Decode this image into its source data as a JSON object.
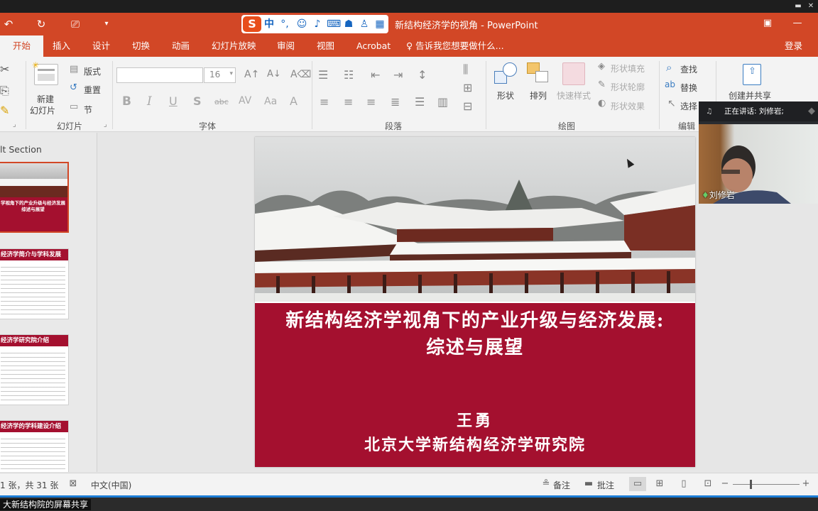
{
  "titlebar": {
    "title": "新结构经济学的视角 - PowerPoint",
    "ime": {
      "logo": "S",
      "mode": "中",
      "punct": "°,"
    }
  },
  "tabs": [
    {
      "label": "开始"
    },
    {
      "label": "插入"
    },
    {
      "label": "设计"
    },
    {
      "label": "切换"
    },
    {
      "label": "动画"
    },
    {
      "label": "幻灯片放映"
    },
    {
      "label": "审阅"
    },
    {
      "label": "视图"
    },
    {
      "label": "Acrobat"
    }
  ],
  "tellme": "告诉我您想要做什么...",
  "login": "登录",
  "ribbon": {
    "slides": {
      "new_slide": "新建",
      "new_slide2": "幻灯片",
      "layout": "版式",
      "reset": "重置",
      "section": "节",
      "group": "幻灯片"
    },
    "font": {
      "size": "16",
      "group": "字体",
      "bold": "B",
      "italic": "I",
      "underline": "U",
      "shadow": "S",
      "strike": "abc",
      "spacing": "AV",
      "case": "Aa",
      "color": "A"
    },
    "paragraph": {
      "group": "段落"
    },
    "drawing": {
      "shapes": "形状",
      "arrange": "排列",
      "quick_styles": "快速样式",
      "fill": "形状填充",
      "outline": "形状轮廓",
      "effects": "形状效果",
      "group": "绘图"
    },
    "editing": {
      "find": "查找",
      "replace": "替换",
      "select": "选择",
      "group": "编辑"
    },
    "share": {
      "label": "创建并共享"
    }
  },
  "thumbnails": {
    "section": "lt Section",
    "items": [
      {
        "head": "学视角下的产业升级与经济发展",
        "sub": "综述与展望"
      },
      {
        "head": "经济学简介与学科发展"
      },
      {
        "head": "经济学研究院介绍"
      },
      {
        "head": "经济学的学科建设介绍"
      }
    ]
  },
  "slide": {
    "title_line1": "新结构经济学视角下的产业升级与经济发展:",
    "title_line2": "综述与展望",
    "author": "王勇",
    "institution": "北京大学新结构经济学研究院"
  },
  "video": {
    "speaking": "正在讲话: 刘修岩;",
    "name": "刘修岩"
  },
  "status": {
    "slide_count": "1 张，共 31 张",
    "language": "中文(中国)",
    "notes": "备注",
    "comments": "批注"
  },
  "share": {
    "label": "大新结构院的屏幕共享"
  },
  "colors": {
    "accent": "#d24726",
    "slide_red": "#a4102f"
  }
}
